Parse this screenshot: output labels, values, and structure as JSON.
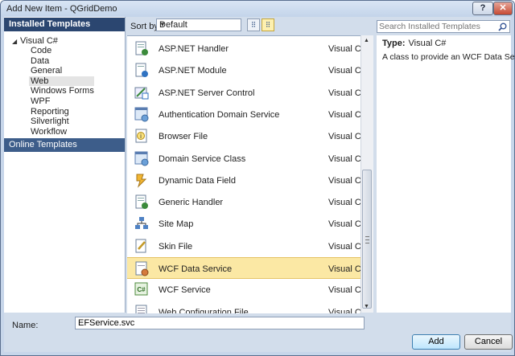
{
  "window": {
    "title": "Add New Item - QGridDemo",
    "help_label": "?",
    "close_label": "✕"
  },
  "left": {
    "installed_header": "Installed Templates",
    "root": "Visual C#",
    "children": [
      "Code",
      "Data",
      "General",
      "Web",
      "Windows Forms",
      "WPF",
      "Reporting",
      "Silverlight",
      "Workflow"
    ],
    "selected_child": "Web",
    "online_header": "Online Templates"
  },
  "sort": {
    "label": "Sort by:",
    "value": "Default"
  },
  "search": {
    "placeholder": "Search Installed Templates"
  },
  "items": [
    {
      "name": "ASP.NET Handler",
      "lang": "Visual C#",
      "icon": "handler-icon"
    },
    {
      "name": "ASP.NET Module",
      "lang": "Visual C#",
      "icon": "module-icon"
    },
    {
      "name": "ASP.NET Server Control",
      "lang": "Visual C#",
      "icon": "server-control-icon"
    },
    {
      "name": "Authentication Domain Service",
      "lang": "Visual C#",
      "icon": "domain-service-icon"
    },
    {
      "name": "Browser File",
      "lang": "Visual C#",
      "icon": "browser-file-icon"
    },
    {
      "name": "Domain Service Class",
      "lang": "Visual C#",
      "icon": "domain-service-icon"
    },
    {
      "name": "Dynamic Data Field",
      "lang": "Visual C#",
      "icon": "dynamic-data-icon"
    },
    {
      "name": "Generic Handler",
      "lang": "Visual C#",
      "icon": "handler-icon"
    },
    {
      "name": "Site Map",
      "lang": "Visual C#",
      "icon": "site-map-icon"
    },
    {
      "name": "Skin File",
      "lang": "Visual C#",
      "icon": "skin-file-icon"
    },
    {
      "name": "WCF Data Service",
      "lang": "Visual C#",
      "icon": "wcf-data-service-icon"
    },
    {
      "name": "WCF Service",
      "lang": "Visual C#",
      "icon": "wcf-service-icon"
    },
    {
      "name": "Web Configuration File",
      "lang": "Visual C#",
      "icon": "config-file-icon"
    }
  ],
  "selected_item": "WCF Data Service",
  "details": {
    "type_label": "Type:",
    "type_value": "Visual C#",
    "description": "A class to provide an WCF Data Service."
  },
  "footer": {
    "name_label": "Name:",
    "name_value": "EFService.svc",
    "add_label": "Add",
    "cancel_label": "Cancel"
  },
  "colors": {
    "header_bg": "#2b4670",
    "online_bg": "#3d5d8a",
    "selection": "#fbe8a4",
    "chrome": "#d2ddeb"
  }
}
